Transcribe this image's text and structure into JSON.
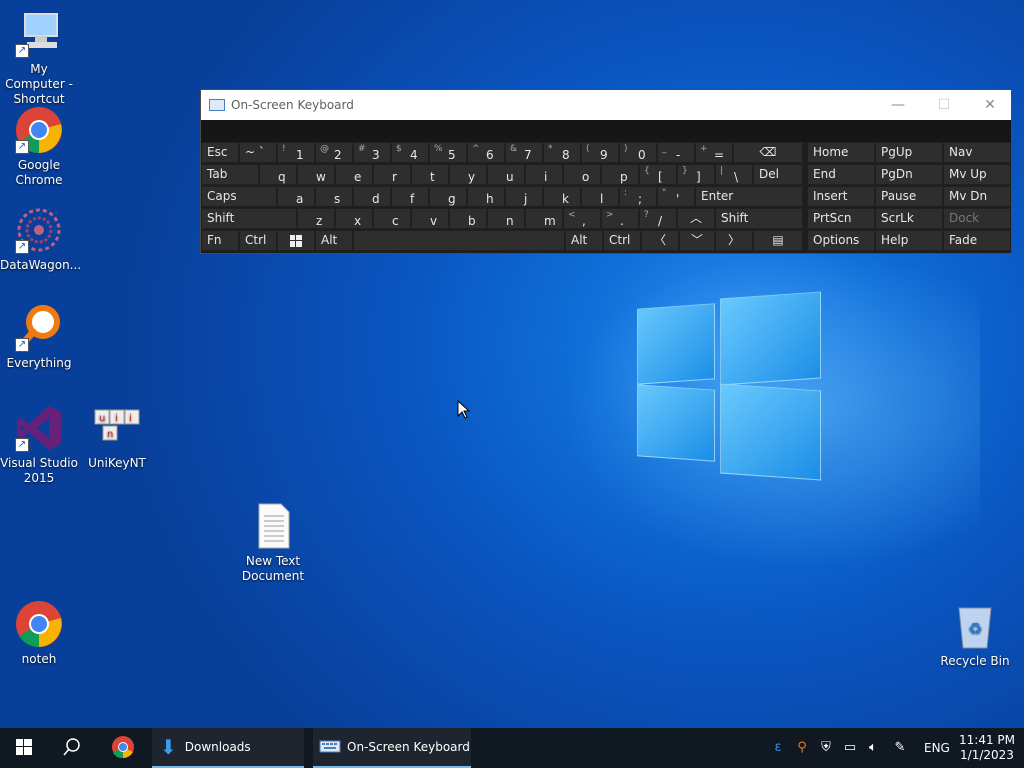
{
  "desktop": {
    "icons": [
      {
        "label": "My Computer - Shortcut",
        "icon": "computer-icon"
      },
      {
        "label": "Google Chrome",
        "icon": "chrome-icon"
      },
      {
        "label": "DataWagon...",
        "icon": "datawagon-icon"
      },
      {
        "label": "Everything",
        "icon": "everything-search-icon"
      },
      {
        "label": "Visual Studio 2015",
        "icon": "visual-studio-icon"
      },
      {
        "label": "UniKeyNT",
        "icon": "unikey-icon"
      },
      {
        "label": "New Text Document",
        "icon": "text-document-icon"
      },
      {
        "label": "noteh",
        "icon": "chrome-icon"
      },
      {
        "label": "Recycle Bin",
        "icon": "recycle-bin-icon"
      }
    ]
  },
  "osk": {
    "title": "On-Screen Keyboard",
    "row1": {
      "esc": "Esc",
      "k1": "1",
      "k2": "2",
      "k3": "3",
      "k4": "4",
      "k5": "5",
      "k6": "6",
      "k7": "7",
      "k8": "8",
      "k9": "9",
      "k0": "0",
      "minus": "-",
      "eq": "=",
      "s_tilde": "~ `",
      "s1": "!",
      "s2": "@",
      "s3": "#",
      "s4": "$",
      "s5": "%",
      "s6": "^",
      "s7": "&",
      "s8": "*",
      "s9": "(",
      "s0": ")",
      "s_minus": "_",
      "s_eq": "+"
    },
    "row2": {
      "tab": "Tab",
      "q": "q",
      "w": "w",
      "e": "e",
      "r": "r",
      "t": "t",
      "y": "y",
      "u": "u",
      "i": "i",
      "o": "o",
      "p": "p",
      "lb": "[",
      "rb": "]",
      "bs": "\\",
      "del": "Del",
      "s_lb": "{",
      "s_rb": "}",
      "s_bs": "|"
    },
    "row3": {
      "caps": "Caps",
      "a": "a",
      "s": "s",
      "d": "d",
      "f": "f",
      "g": "g",
      "h": "h",
      "j": "j",
      "k": "k",
      "l": "l",
      "semi": ";",
      "quote": "'",
      "enter": "Enter",
      "s_semi": ":",
      "s_quote": "\""
    },
    "row4": {
      "shift": "Shift",
      "z": "z",
      "x": "x",
      "c": "c",
      "v": "v",
      "b": "b",
      "n": "n",
      "m": "m",
      "comma": ",",
      "dot": ".",
      "slash": "/",
      "rshift": "Shift",
      "s_comma": "<",
      "s_dot": ">",
      "s_slash": "?"
    },
    "row5": {
      "fn": "Fn",
      "ctrl": "Ctrl",
      "alt": "Alt",
      "ralt": "Alt",
      "rctrl": "Ctrl"
    },
    "nav": {
      "home": "Home",
      "pgup": "PgUp",
      "nav": "Nav",
      "end": "End",
      "pgdn": "PgDn",
      "mvup": "Mv Up",
      "insert": "Insert",
      "pause": "Pause",
      "mvdn": "Mv Dn",
      "prtscn": "PrtScn",
      "scrlk": "ScrLk",
      "dock": "Dock",
      "options": "Options",
      "help": "Help",
      "fade": "Fade"
    }
  },
  "taskbar": {
    "downloads": "Downloads",
    "osk": "On-Screen Keyboard",
    "lang": "ENG",
    "time": "11:41 PM",
    "date": "1/1/2023"
  }
}
